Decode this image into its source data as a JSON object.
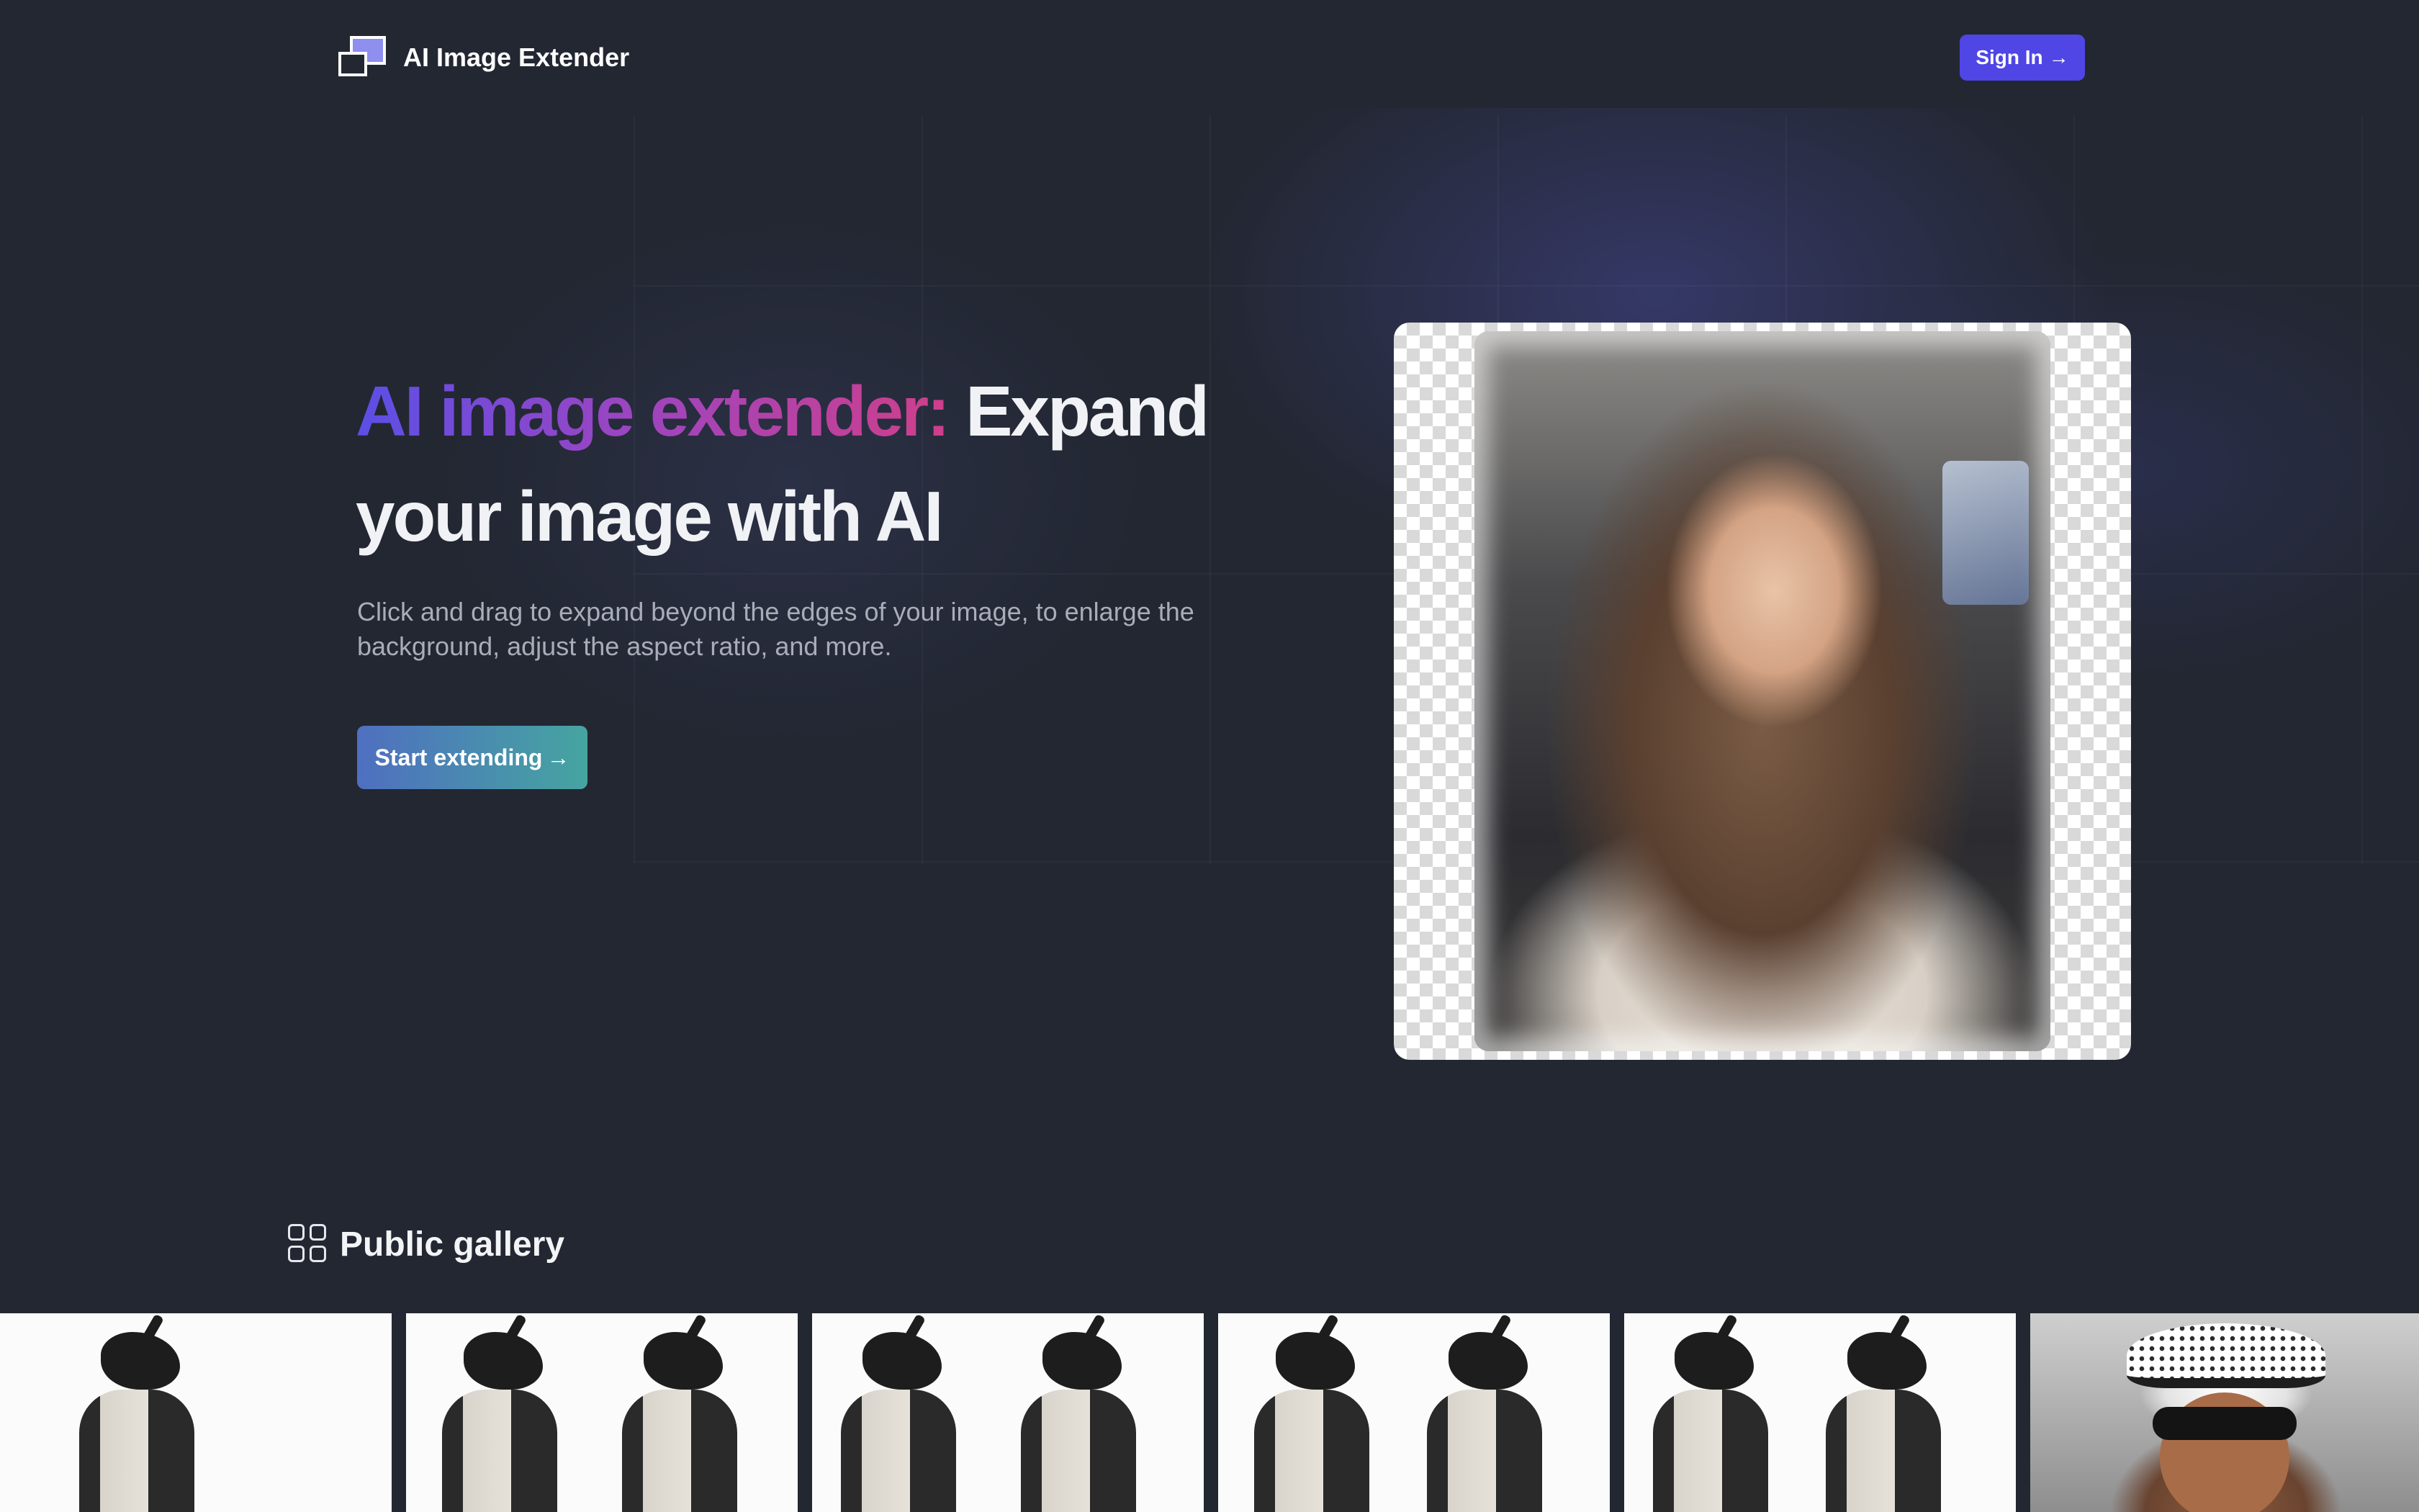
{
  "header": {
    "brand_name": "AI Image Extender",
    "signin_label": "Sign In",
    "signin_arrow": "→"
  },
  "hero": {
    "title_accent": "AI image extender:",
    "title_rest": " Expand your image with AI",
    "subtitle": "Click and drag to expand beyond the edges of your image, to enlarge the background, adjust the aspect ratio, and more.",
    "cta_label": "Start extending",
    "cta_arrow": "→"
  },
  "gallery": {
    "title": "Public gallery",
    "items": [
      {
        "kind": "dragon-illustration"
      },
      {
        "kind": "dragon-illustration"
      },
      {
        "kind": "dragon-illustration"
      },
      {
        "kind": "dragon-illustration"
      },
      {
        "kind": "dragon-illustration"
      },
      {
        "kind": "photo-person-hat"
      }
    ]
  },
  "colors": {
    "page_background": "#232732",
    "signin_button": "#4f46e5",
    "accent_gradient_start": "#5b4fe6",
    "accent_gradient_end": "#cf3f8a",
    "cta_gradient_start": "#4f6fc0",
    "cta_gradient_end": "#45a5a0"
  },
  "icons": {
    "brand": "overlapping-squares-logo-icon",
    "gallery": "grid-four-squares-icon",
    "arrow": "arrow-right-icon"
  }
}
